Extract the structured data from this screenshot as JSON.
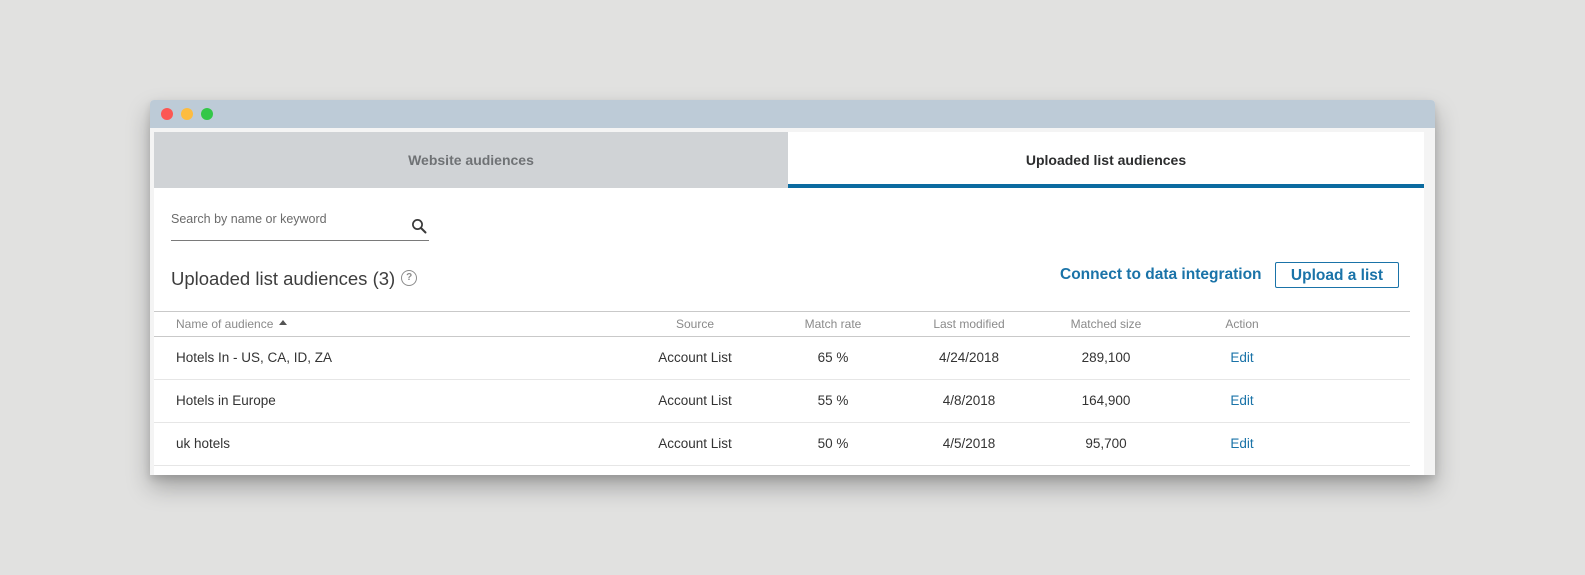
{
  "tabs": [
    {
      "label": "Website audiences",
      "active": false
    },
    {
      "label": "Uploaded list audiences",
      "active": true
    }
  ],
  "search": {
    "placeholder": "Search by name or keyword",
    "value": ""
  },
  "section": {
    "title": "Uploaded list audiences (3)",
    "help_icon": "question-circle-icon"
  },
  "actions": {
    "connect_label": "Connect to data integration",
    "upload_label": "Upload a list"
  },
  "table": {
    "columns": [
      "Name of audience",
      "Source",
      "Match rate",
      "Last modified",
      "Matched size",
      "Action"
    ],
    "sort_icon": "sort-ascending-icon",
    "rows": [
      {
        "name": "Hotels In - US, CA, ID, ZA",
        "source": "Account List",
        "match_rate": "65 %",
        "last_modified": "4/24/2018",
        "matched_size": "289,100",
        "action": "Edit"
      },
      {
        "name": "Hotels in Europe",
        "source": "Account List",
        "match_rate": "55 %",
        "last_modified": "4/8/2018",
        "matched_size": "164,900",
        "action": "Edit"
      },
      {
        "name": "uk hotels",
        "source": "Account List",
        "match_rate": "50 %",
        "last_modified": "4/5/2018",
        "matched_size": "95,700",
        "action": "Edit"
      }
    ]
  },
  "colors": {
    "accent": "#0b6ba0",
    "link": "#1a73a8",
    "titlebar": "#bdcbd7",
    "inactive_tab": "#d0d3d6"
  }
}
